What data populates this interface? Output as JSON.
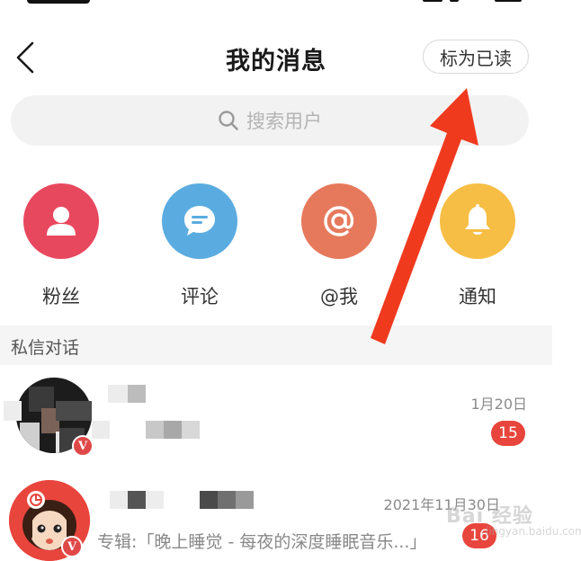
{
  "header": {
    "title": "我的消息",
    "mark_read_label": "标为已读"
  },
  "search": {
    "placeholder": "搜索用户"
  },
  "shortcuts": [
    {
      "label": "粉丝",
      "icon": "person-icon",
      "color": "#e8485e"
    },
    {
      "label": "评论",
      "icon": "comment-bubble-icon",
      "color": "#5aace0"
    },
    {
      "label": "@我",
      "icon": "at-icon",
      "color": "#e6795c"
    },
    {
      "label": "通知",
      "icon": "bell-icon",
      "color": "#f6be44"
    }
  ],
  "section": {
    "title": "私信对话"
  },
  "conversations": [
    {
      "date": "1月20日",
      "unread": "15",
      "verified": "V"
    },
    {
      "date": "2021年11月30日",
      "unread": "16",
      "verified": "V",
      "preview": "专辑:「晚上睡觉 - 每夜的深度睡眠音乐...」"
    }
  ],
  "watermark": {
    "text": "Bai 经验",
    "sub": "jingyan.baidu.com"
  },
  "colors": {
    "accent_red": "#e8453c",
    "arrow_red": "#f03a1e"
  }
}
